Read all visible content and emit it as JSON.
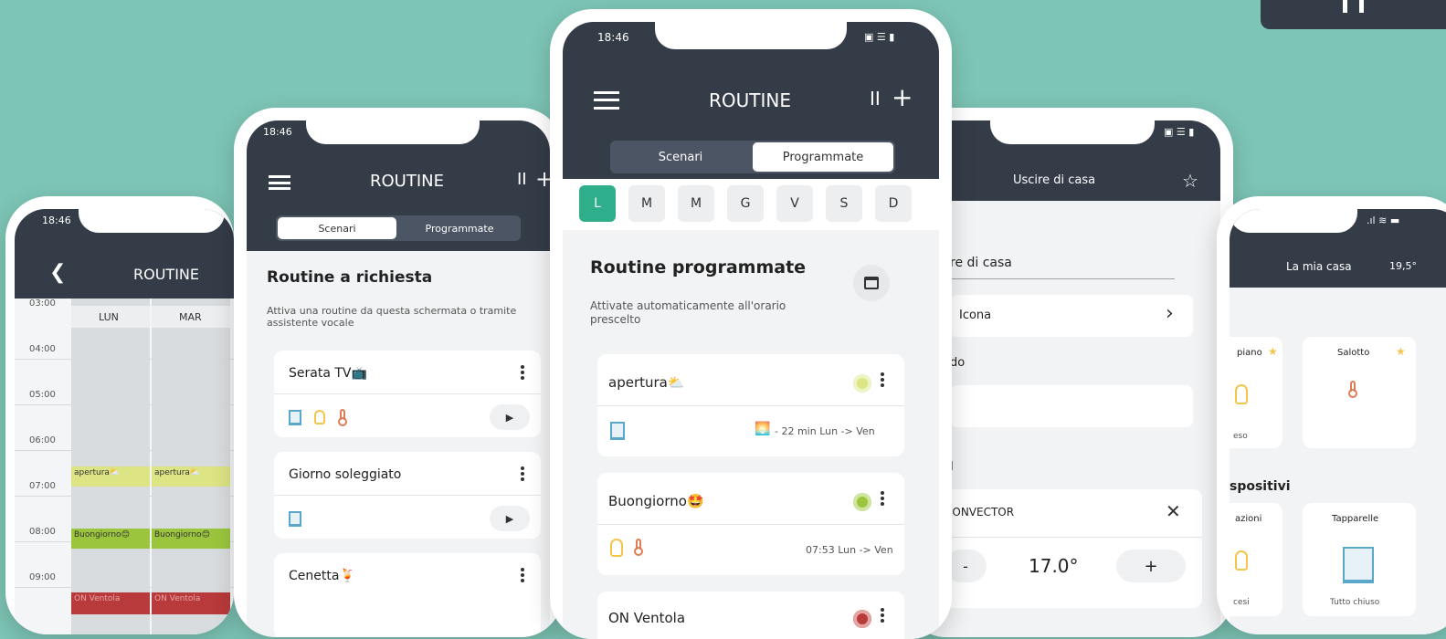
{
  "status_time": "18:46",
  "phone_calendar": {
    "title": "ROUTINE",
    "days": [
      "LUN",
      "MAR"
    ],
    "times": [
      "03:00",
      "04:00",
      "05:00",
      "06:00",
      "07:00",
      "08:00",
      "09:00"
    ],
    "events": {
      "apertura": "apertura",
      "buongiorno": "Buongiorno",
      "on_ventola": "ON Ventola"
    }
  },
  "phone_scenari": {
    "title": "ROUTINE",
    "tabs": [
      "Scenari",
      "Programmate"
    ],
    "section_title": "Routine a richiesta",
    "section_desc": "Attiva una routine da questa schermata o tramite assistente vocale",
    "cards": [
      "Serata TV",
      "Giorno soleggiato",
      "Cenetta"
    ]
  },
  "phone_programmate": {
    "title": "ROUTINE",
    "tabs": [
      "Scenari",
      "Programmate"
    ],
    "days": [
      "L",
      "M",
      "M",
      "G",
      "V",
      "S",
      "D"
    ],
    "section_title": "Routine programmate",
    "section_desc": "Attivate automaticamente all'orario prescelto",
    "cards": [
      {
        "name": "apertura",
        "schedule": "- 22 min  Lun -> Ven"
      },
      {
        "name": "Buongiorno",
        "schedule": "07:53  Lun -> Ven"
      },
      {
        "name": "ON Ventola"
      }
    ]
  },
  "phone_uscire": {
    "title": "Uscire di casa",
    "name_value": "re di casa",
    "icon_label": "Icona",
    "section_label": "do",
    "small_label": "I",
    "device_name": "CONVECTOR",
    "minus": "-",
    "plus": "+",
    "temperature": "17.0°"
  },
  "phone_casa": {
    "title": "La mia casa",
    "temp": "19,5°",
    "rooms": [
      "piano",
      "Salotto"
    ],
    "room_status": "eso",
    "section_title": "spositivi",
    "categories": [
      "azioni",
      "Tapparelle"
    ],
    "category_status": [
      "cesi",
      "Tutto chiuso"
    ]
  },
  "colors": {
    "background": "#7dc5b6",
    "header": "#343c48",
    "accent": "#2fae8c",
    "event_yellow": "#dde483",
    "event_green": "#9bc53d",
    "event_red": "#b83a3a"
  }
}
